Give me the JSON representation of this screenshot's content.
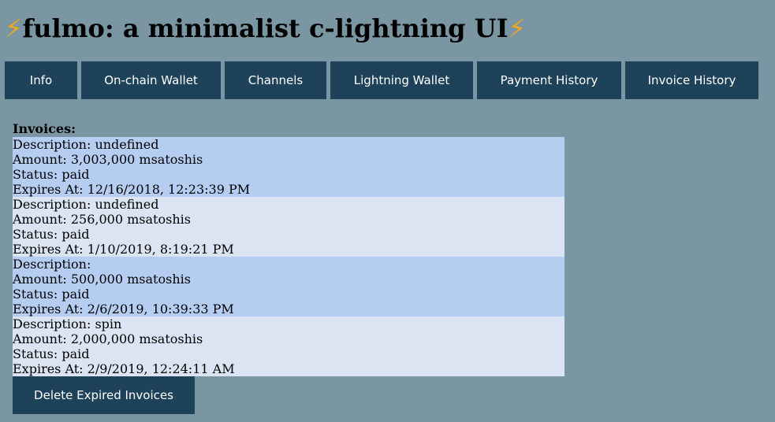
{
  "header": {
    "title": "fulmo: a minimalist c-lightning UI",
    "bolt_icon": "⚡"
  },
  "nav": {
    "items": [
      {
        "label": "Info"
      },
      {
        "label": "On-chain Wallet"
      },
      {
        "label": "Channels"
      },
      {
        "label": "Lightning Wallet"
      },
      {
        "label": "Payment History"
      },
      {
        "label": "Invoice History"
      }
    ]
  },
  "invoices": {
    "heading": "Invoices:",
    "items": [
      {
        "description": "Description: undefined",
        "amount": "Amount: 3,003,000 msatoshis",
        "status": "Status: paid",
        "expires": "Expires At: 12/16/2018, 12:23:39 PM"
      },
      {
        "description": "Description: undefined",
        "amount": "Amount: 256,000 msatoshis",
        "status": "Status: paid",
        "expires": "Expires At: 1/10/2019, 8:19:21 PM"
      },
      {
        "description": "Description:",
        "amount": "Amount: 500,000 msatoshis",
        "status": "Status: paid",
        "expires": "Expires At: 2/6/2019, 10:39:33 PM"
      },
      {
        "description": "Description: spin",
        "amount": "Amount: 2,000,000 msatoshis",
        "status": "Status: paid",
        "expires": "Expires At: 2/9/2019, 12:24:11 AM"
      }
    ],
    "delete_label": "Delete Expired Invoices"
  },
  "colors": {
    "background": "#7b96a3",
    "button": "#1e4259",
    "row_highlight": "#b4cdf0",
    "row_light": "#dae4f2",
    "bolt": "#f2a81d"
  }
}
